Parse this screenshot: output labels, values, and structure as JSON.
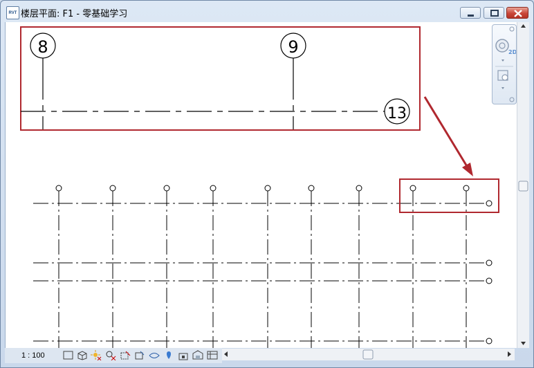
{
  "window": {
    "title": "楼层平面: F1 - 零基础学习",
    "app_icon_text": "RVT",
    "controls": [
      "minimize-icon",
      "maximize-icon",
      "close-icon"
    ]
  },
  "inset_view": {
    "grid_labels": [
      "8",
      "9",
      "13"
    ],
    "highlight_color": "#b0282f"
  },
  "plan_view": {
    "vertical_grid_count": 9,
    "horizontal_grid_count": 4
  },
  "nav_bar": {
    "label_2d": "2D",
    "icons": [
      "steering-wheel-icon",
      "zoom-region-icon"
    ]
  },
  "status_bar": {
    "scale": "1 : 100",
    "icons": [
      "detail-level-icon",
      "visual-style-icon",
      "sun-path-icon",
      "shadows-icon",
      "crop-view-icon",
      "show-crop-icon",
      "temporary-hide-icon",
      "reveal-hidden-icon",
      "lock-3d-icon",
      "analysis-display-icon",
      "worksharing-icon",
      "design-options-icon"
    ]
  }
}
